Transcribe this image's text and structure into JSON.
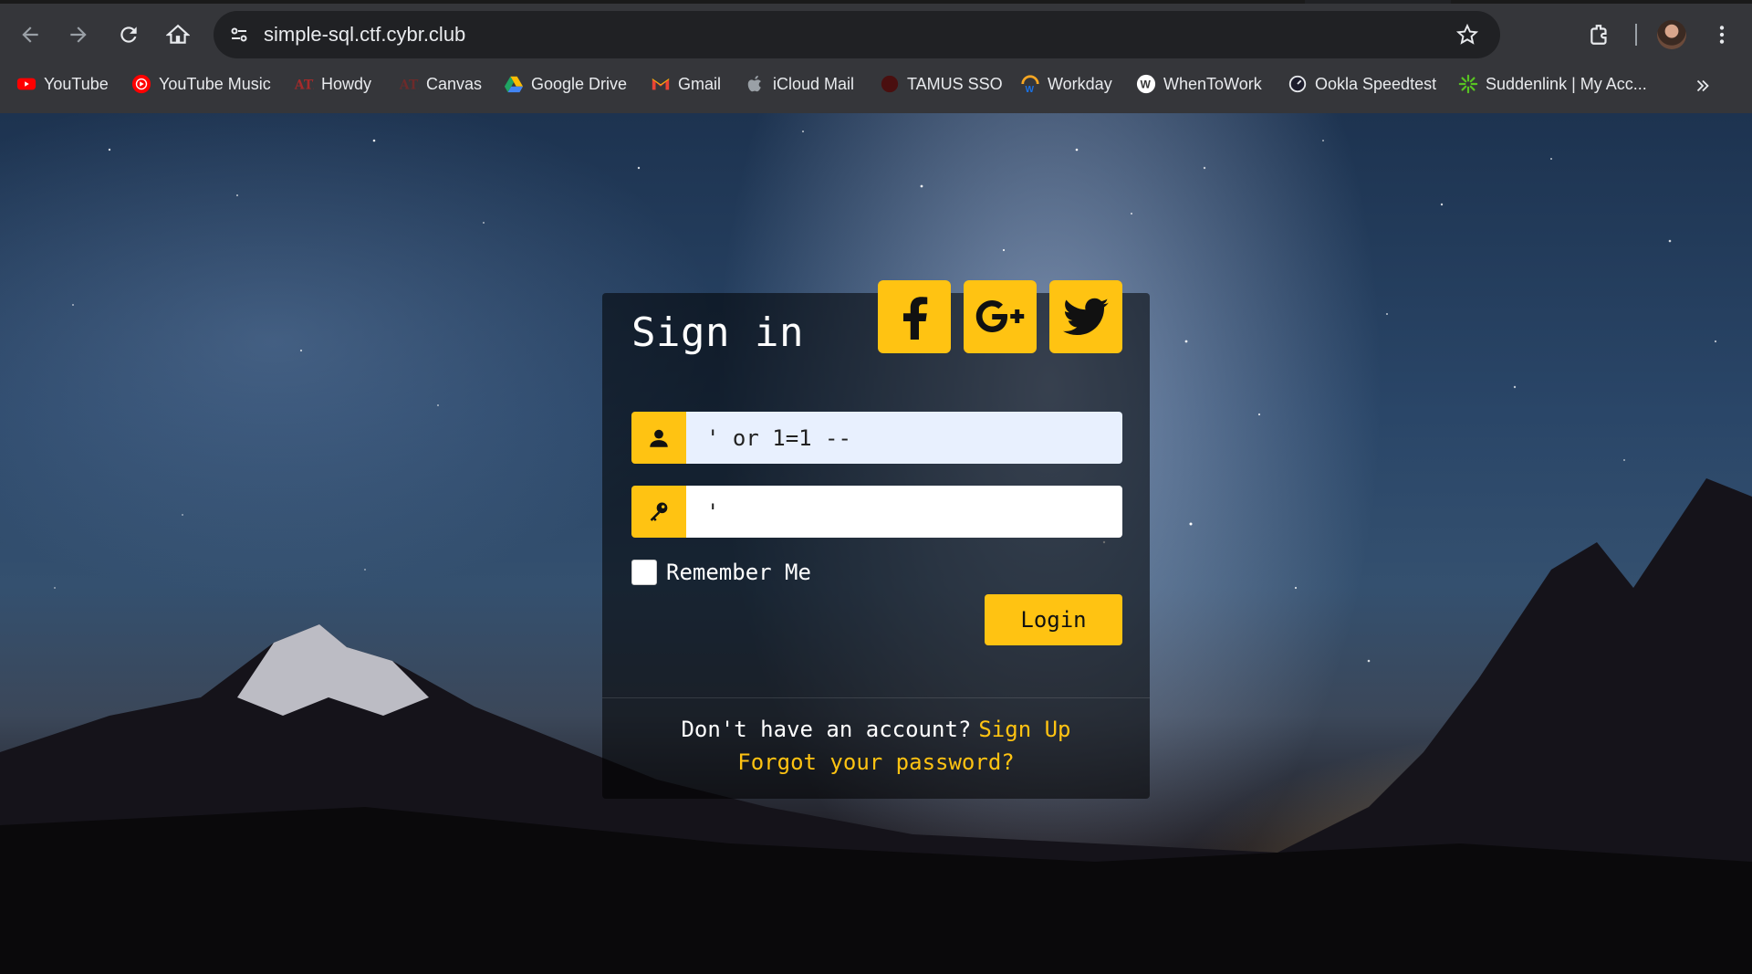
{
  "browser": {
    "url": "simple-sql.ctf.cybr.club",
    "nav": {
      "back_icon": "arrow-left",
      "forward_icon": "arrow-right",
      "reload_icon": "reload",
      "home_icon": "home"
    },
    "bookmarks": [
      {
        "label": "YouTube",
        "icon": "youtube",
        "color": "#ff0000"
      },
      {
        "label": "YouTube Music",
        "icon": "youtube-music",
        "color": "#ff0000"
      },
      {
        "label": "Howdy",
        "icon": "tamu-logo",
        "color": "#8b1d1d"
      },
      {
        "label": "Canvas",
        "icon": "tamu-logo",
        "color": "#8b1d1d"
      },
      {
        "label": "Google Drive",
        "icon": "google-drive",
        "color": "#1fa463"
      },
      {
        "label": "Gmail",
        "icon": "gmail",
        "color": "#ea4335"
      },
      {
        "label": "iCloud Mail",
        "icon": "apple",
        "color": "#9aa0a6"
      },
      {
        "label": "TAMUS SSO",
        "icon": "tamus",
        "color": "#5a1010"
      },
      {
        "label": "Workday",
        "icon": "workday",
        "color": "#f5a623"
      },
      {
        "label": "WhenToWork",
        "icon": "whentowork",
        "color": "#ffffff"
      },
      {
        "label": "Ookla Speedtest",
        "icon": "speedtest",
        "color": "#e8eaed"
      },
      {
        "label": "Suddenlink | My Acc...",
        "icon": "suddenlink",
        "color": "#58c322"
      }
    ]
  },
  "login": {
    "title": "Sign in",
    "social": [
      "facebook-icon",
      "google-plus-icon",
      "twitter-icon"
    ],
    "username_value": "' or 1=1 --",
    "password_value": "'",
    "remember_label": "Remember Me",
    "login_label": "Login",
    "no_account_text": "Don't have an account?",
    "signup_label": "Sign Up",
    "forgot_label": "Forgot your password?",
    "accent_color": "#ffc312"
  }
}
